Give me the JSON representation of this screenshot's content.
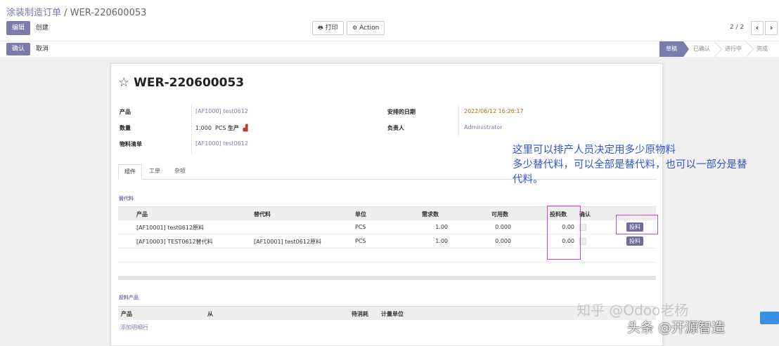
{
  "breadcrumb": {
    "parent": "涂装制造订单",
    "separator": " / ",
    "current": "WER-220600053"
  },
  "toolbar": {
    "edit": "编辑",
    "create": "创建",
    "print": "打印",
    "action": "Action",
    "pager": "2 / 2"
  },
  "statusbar": {
    "confirm": "确认",
    "cancel": "取消",
    "stages": [
      "草稿",
      "已确认",
      "进行中",
      "完成"
    ],
    "active_stage": "草稿"
  },
  "record": {
    "name": "WER-220600053",
    "fields": {
      "product_label": "产品",
      "product_value": "[AF1000] test0612",
      "quantity_label": "数量",
      "quantity_value": "1.000",
      "quantity_uom": "PCS",
      "quantity_produce": "生产",
      "bom_label": "物料清单",
      "bom_value": "[AF1000] test0612",
      "date_label": "安排的日期",
      "date_value": "2022/06/12 16:26:17",
      "responsible_label": "负责人",
      "responsible_value": "Administrator"
    }
  },
  "tabs": [
    "组件",
    "工单",
    "杂项"
  ],
  "substitutes": {
    "section_title": "替代料",
    "headers": [
      "产品",
      "替代料",
      "单位",
      "需求数",
      "可用数",
      "投料数",
      "确认"
    ],
    "rows": [
      {
        "product": "[AF10001] test0612原料",
        "substitute": "",
        "unit": "PCS",
        "required": "1.00",
        "available": "0.000",
        "feed": "0.00",
        "button": "投料"
      },
      {
        "product": "[AF10003] TEST0612替代料",
        "substitute": "[AF10001] test0612原料",
        "unit": "PCS",
        "required": "1.00",
        "available": "0.000",
        "feed": "0.00",
        "button": "投料"
      }
    ]
  },
  "fed_products": {
    "section_title": "投料产品",
    "headers": [
      "产品",
      "从",
      "待消耗",
      "计量单位"
    ],
    "add_line": "添加明细行"
  },
  "annotation": {
    "line1": "这里可以排产人员决定用多少原物料",
    "line2": "多少替代料，可以全部是替代料，也可以一部分是替",
    "line3": "代料。"
  },
  "watermarks": {
    "zhihu": "知乎 @Odoo老杨",
    "toutiao": "头条 @开源智造"
  },
  "colors": {
    "accent": "#7c7bad",
    "annotation": "#2f55d4",
    "highlight": "#d043d0"
  }
}
